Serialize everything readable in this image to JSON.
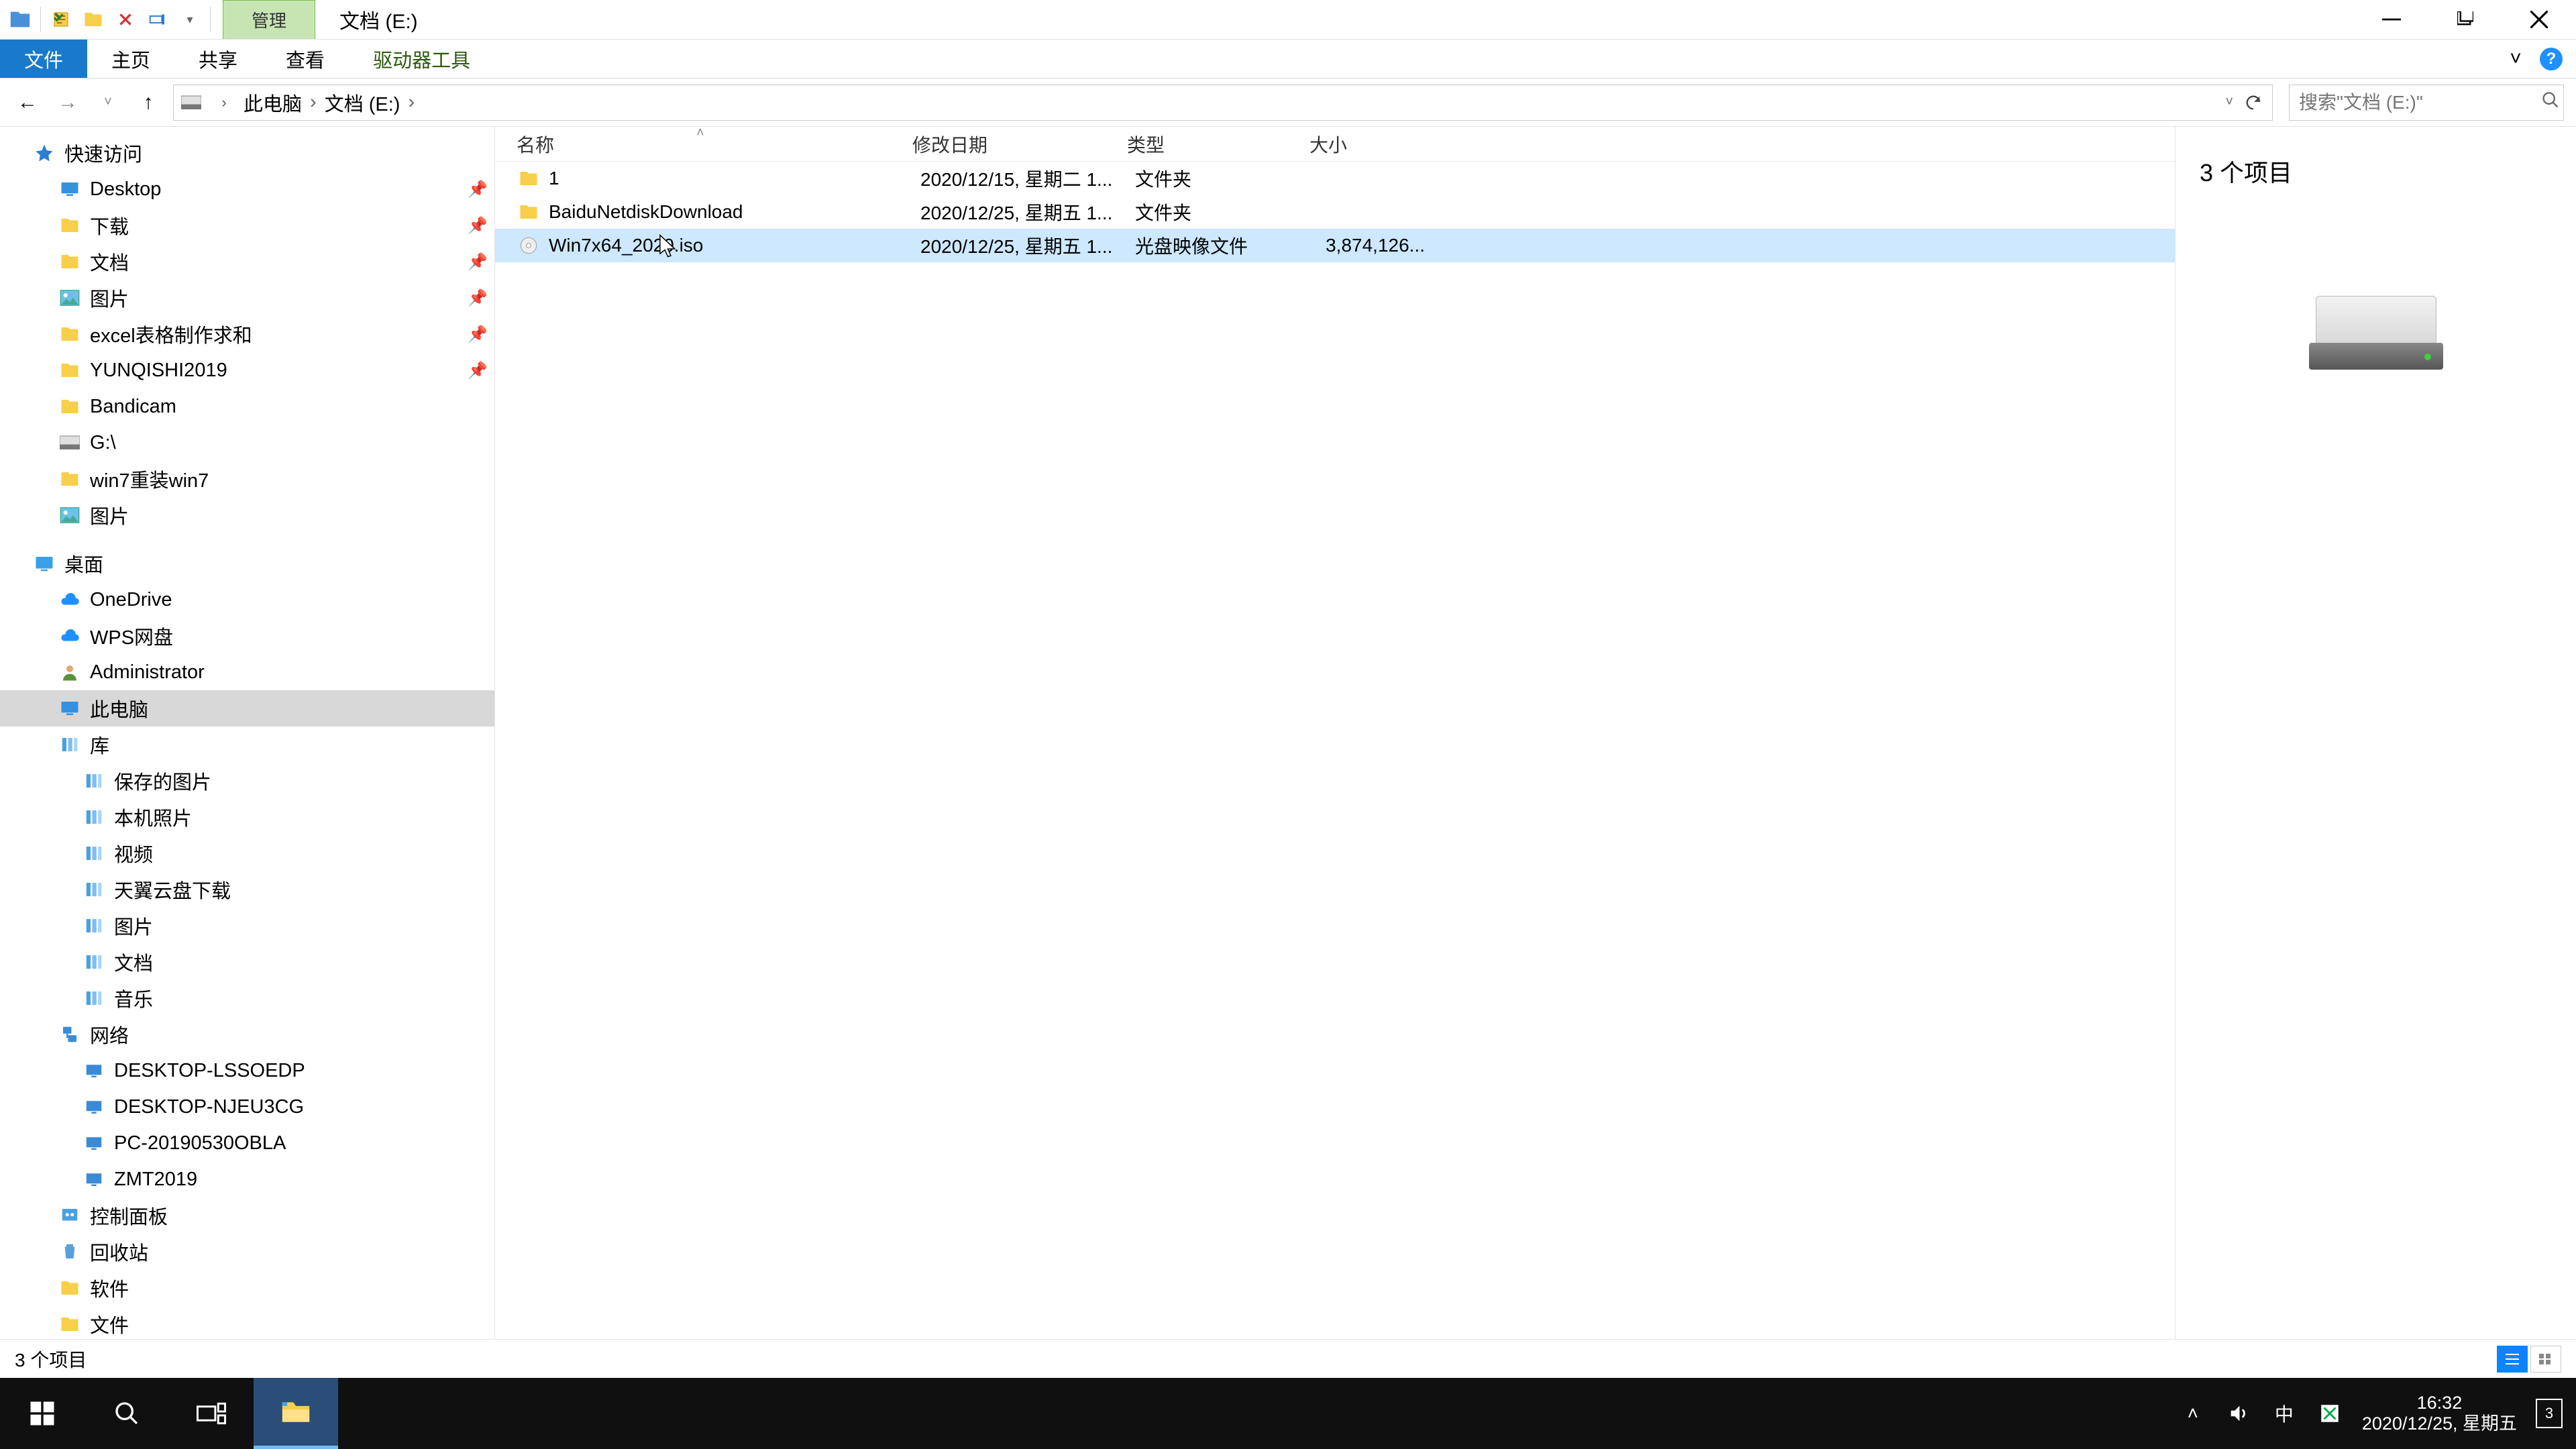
{
  "titlebar": {
    "context_tab": "管理",
    "window_title": "文档 (E:)"
  },
  "ribbon": {
    "file": "文件",
    "home": "主页",
    "share": "共享",
    "view": "查看",
    "drive_tools": "驱动器工具"
  },
  "breadcrumb": {
    "root": "此电脑",
    "current": "文档 (E:)"
  },
  "search": {
    "placeholder": "搜索\"文档 (E:)\""
  },
  "sidebar": {
    "quick_access": "快速访问",
    "items_pinned": [
      {
        "label": "Desktop"
      },
      {
        "label": "下载"
      },
      {
        "label": "文档"
      },
      {
        "label": "图片"
      },
      {
        "label": "excel表格制作求和"
      },
      {
        "label": "YUNQISHI2019"
      },
      {
        "label": "Bandicam"
      },
      {
        "label": "G:\\"
      },
      {
        "label": "win7重装win7"
      },
      {
        "label": "图片"
      }
    ],
    "desktop": "桌面",
    "desktop_children": [
      {
        "label": "OneDrive",
        "icon": "cloud"
      },
      {
        "label": "WPS网盘",
        "icon": "cloud"
      },
      {
        "label": "Administrator",
        "icon": "user"
      },
      {
        "label": "此电脑",
        "icon": "pc",
        "selected": true
      },
      {
        "label": "库",
        "icon": "lib"
      }
    ],
    "libraries": [
      {
        "label": "保存的图片"
      },
      {
        "label": "本机照片"
      },
      {
        "label": "视频"
      },
      {
        "label": "天翼云盘下载"
      },
      {
        "label": "图片"
      },
      {
        "label": "文档"
      },
      {
        "label": "音乐"
      }
    ],
    "network": "网络",
    "network_children": [
      {
        "label": "DESKTOP-LSSOEDP"
      },
      {
        "label": "DESKTOP-NJEU3CG"
      },
      {
        "label": "PC-20190530OBLA"
      },
      {
        "label": "ZMT2019"
      }
    ],
    "control_panel": "控制面板",
    "recycle": "回收站",
    "soft": "软件",
    "files_folder": "文件"
  },
  "columns": {
    "name": "名称",
    "date": "修改日期",
    "type": "类型",
    "size": "大小"
  },
  "rows": [
    {
      "name": "1",
      "date": "2020/12/15, 星期二 1...",
      "type": "文件夹",
      "size": "",
      "icon": "folder"
    },
    {
      "name": "BaiduNetdiskDownload",
      "date": "2020/12/25, 星期五 1...",
      "type": "文件夹",
      "size": "",
      "icon": "folder"
    },
    {
      "name": "Win7x64_2020.iso",
      "date": "2020/12/25, 星期五 1...",
      "type": "光盘映像文件",
      "size": "3,874,126...",
      "icon": "iso",
      "selected": true
    }
  ],
  "preview": {
    "count_text": "3 个项目"
  },
  "statusbar": {
    "text": "3 个项目"
  },
  "taskbar": {
    "time": "16:32",
    "date": "2020/12/25, 星期五",
    "ime": "中",
    "notif_count": "3"
  }
}
